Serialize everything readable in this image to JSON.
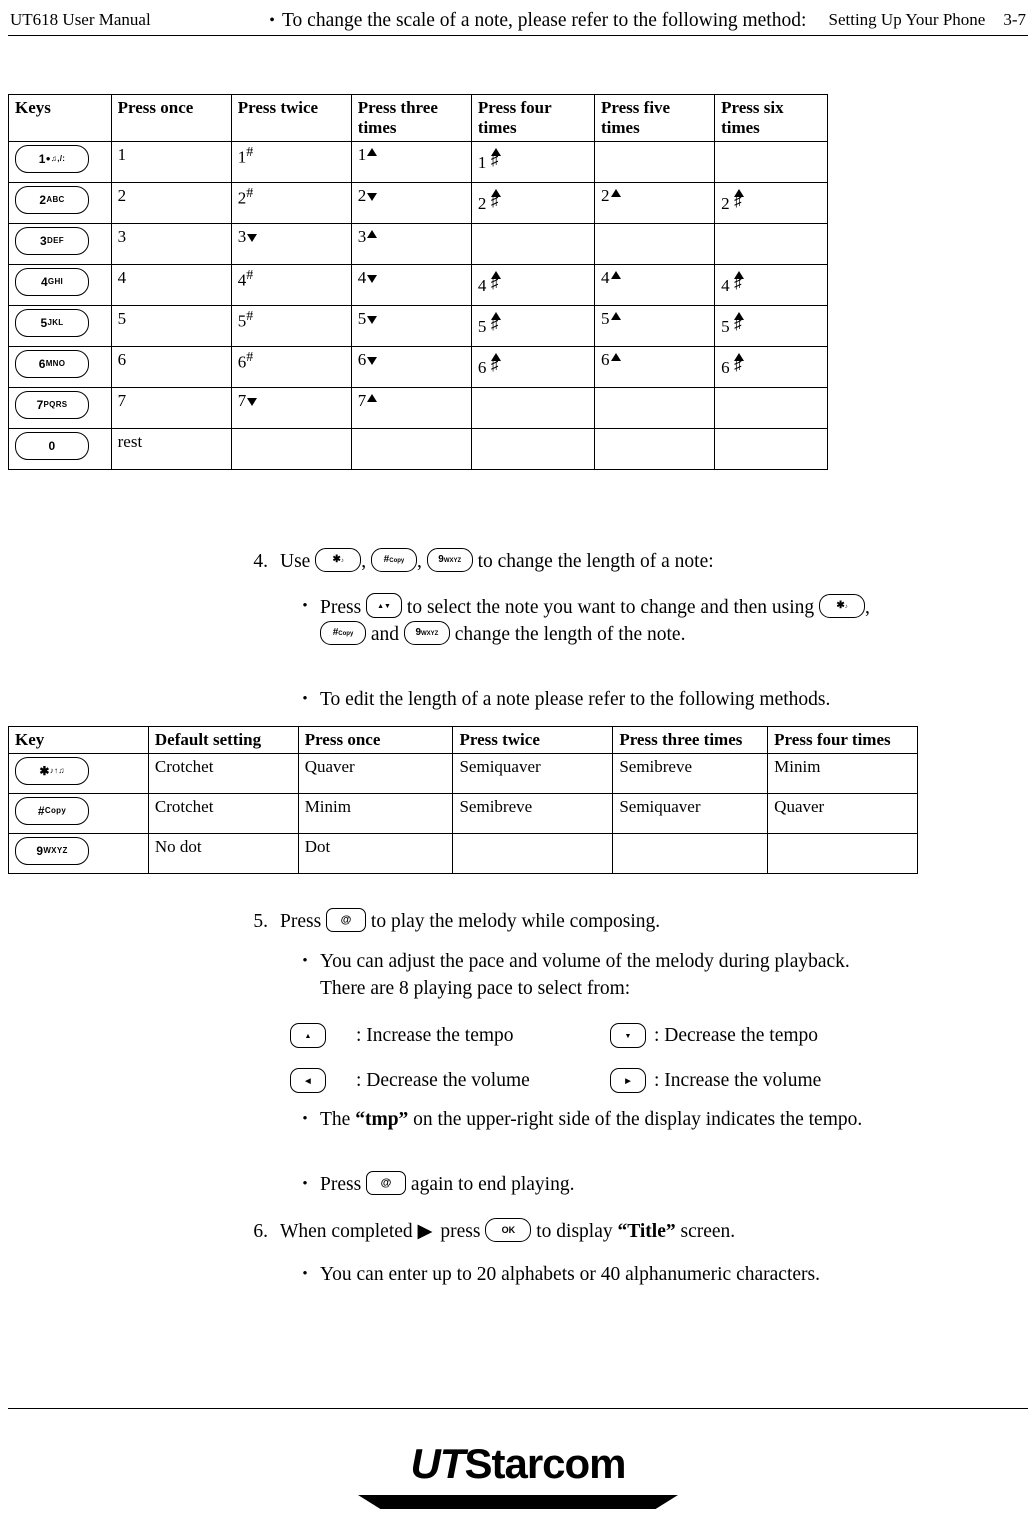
{
  "header": {
    "left": "UT618 User Manual",
    "right": "Setting Up Your Phone",
    "page": "3-7"
  },
  "intro_bullet": "To change the scale of a note, please refer to the following method:",
  "keys_table": {
    "headers": [
      "Keys",
      "Press once",
      "Press twice",
      "Press three times",
      "Press four times",
      "Press five times",
      "Press six times"
    ],
    "rows": [
      {
        "key_label": "1",
        "key_sub": "●♫,/:",
        "cells": [
          "1",
          "1#",
          "1▲",
          "1▲#",
          "",
          ""
        ]
      },
      {
        "key_label": "2",
        "key_sub": "ABC",
        "cells": [
          "2",
          "2#",
          "2▼",
          "2▲#",
          "2▲",
          "2▲#"
        ]
      },
      {
        "key_label": "3",
        "key_sub": "DEF",
        "cells": [
          "3",
          "3▼",
          "3▲",
          "",
          "",
          ""
        ]
      },
      {
        "key_label": "4",
        "key_sub": "GHI",
        "cells": [
          "4",
          "4#",
          "4▼",
          "4▲#",
          "4▲",
          "4▲#"
        ]
      },
      {
        "key_label": "5",
        "key_sub": "JKL",
        "cells": [
          "5",
          "5#",
          "5▼",
          "5▲#",
          "5▲",
          "5▲#"
        ]
      },
      {
        "key_label": "6",
        "key_sub": "MNO",
        "cells": [
          "6",
          "6#",
          "6▼",
          "6▲#",
          "6▲",
          "6▲#"
        ]
      },
      {
        "key_label": "7",
        "key_sub": "PQRS",
        "cells": [
          "7",
          "7▼",
          "7▲",
          "",
          "",
          ""
        ]
      },
      {
        "key_label": "0",
        "key_sub": "",
        "cells": [
          "rest",
          "",
          "",
          "",
          "",
          ""
        ]
      }
    ]
  },
  "step4": {
    "number": "4.",
    "text_before": "Use",
    "text_mid1": ",",
    "text_mid2": ",",
    "text_after": "to change the length of a note:",
    "key1": {
      "big": "✳",
      "sub": "♫↑♪"
    },
    "key2": {
      "big": "#",
      "sub": "Copy"
    },
    "key3": {
      "big": "9",
      "sub": "WXYZ"
    }
  },
  "sub4a": {
    "part1": "Press",
    "part2": "to select the note you want to change and then using",
    "part3": ",",
    "part4": "and",
    "part5": "change the length of the note.",
    "navkey": {
      "big": "▲",
      "sub": "▼"
    }
  },
  "sub4b": "To edit the length of a note please refer to the following methods.",
  "note_table": {
    "headers": [
      "Key",
      "Default setting",
      "Press once",
      "Press twice",
      "Press three times",
      "Press four times"
    ],
    "rows": [
      {
        "key": {
          "big": "✳",
          "sub": "♫↑♪"
        },
        "cells": [
          "Crotchet",
          "Quaver",
          "Semiquaver",
          "Semibreve",
          "Minim"
        ]
      },
      {
        "key": {
          "big": "#",
          "sub": "Copy"
        },
        "cells": [
          "Crotchet",
          "Minim",
          "Semibreve",
          "Semiquaver",
          "Quaver"
        ]
      },
      {
        "key": {
          "big": "9",
          "sub": "WXYZ"
        },
        "cells": [
          "No dot",
          "Dot",
          "",
          "",
          ""
        ]
      }
    ]
  },
  "step5": {
    "number": "5.",
    "text_before": "Press",
    "text_after": "to play the melody while composing.",
    "key": {
      "big": "@",
      "sub": ""
    }
  },
  "sub5a": {
    "line1": "You can adjust the pace and volume of the melody during playback.",
    "line2": "There are 8 playing pace to select from:"
  },
  "tempo": [
    {
      "left_key": "up",
      "left_label": ": Increase the tempo",
      "right_key": "down",
      "right_label": ": Decrease the tempo"
    },
    {
      "left_key": "vol-down",
      "left_label": ": Decrease the volume",
      "right_key": "vol-up",
      "right_label": ": Increase the volume"
    }
  ],
  "sub5b": {
    "p1": "The",
    "bold": "“tmp”",
    "p2": "on the upper-right side of the display indicates the",
    "p3": "tempo."
  },
  "sub5c": {
    "p1": "Press",
    "p2": "again to end playing.",
    "key": {
      "big": "@",
      "sub": ""
    }
  },
  "step6": {
    "number": "6.",
    "p1": "When completed",
    "p2": "press",
    "p3": "to display",
    "bold": "“Title”",
    "p4": "screen.",
    "okkey": "OK"
  },
  "sub6a": "You can enter up to 20 alphabets or 40 alphanumeric characters.",
  "footer": {
    "logo_ut": "UT",
    "logo_rest": "Starcom"
  }
}
